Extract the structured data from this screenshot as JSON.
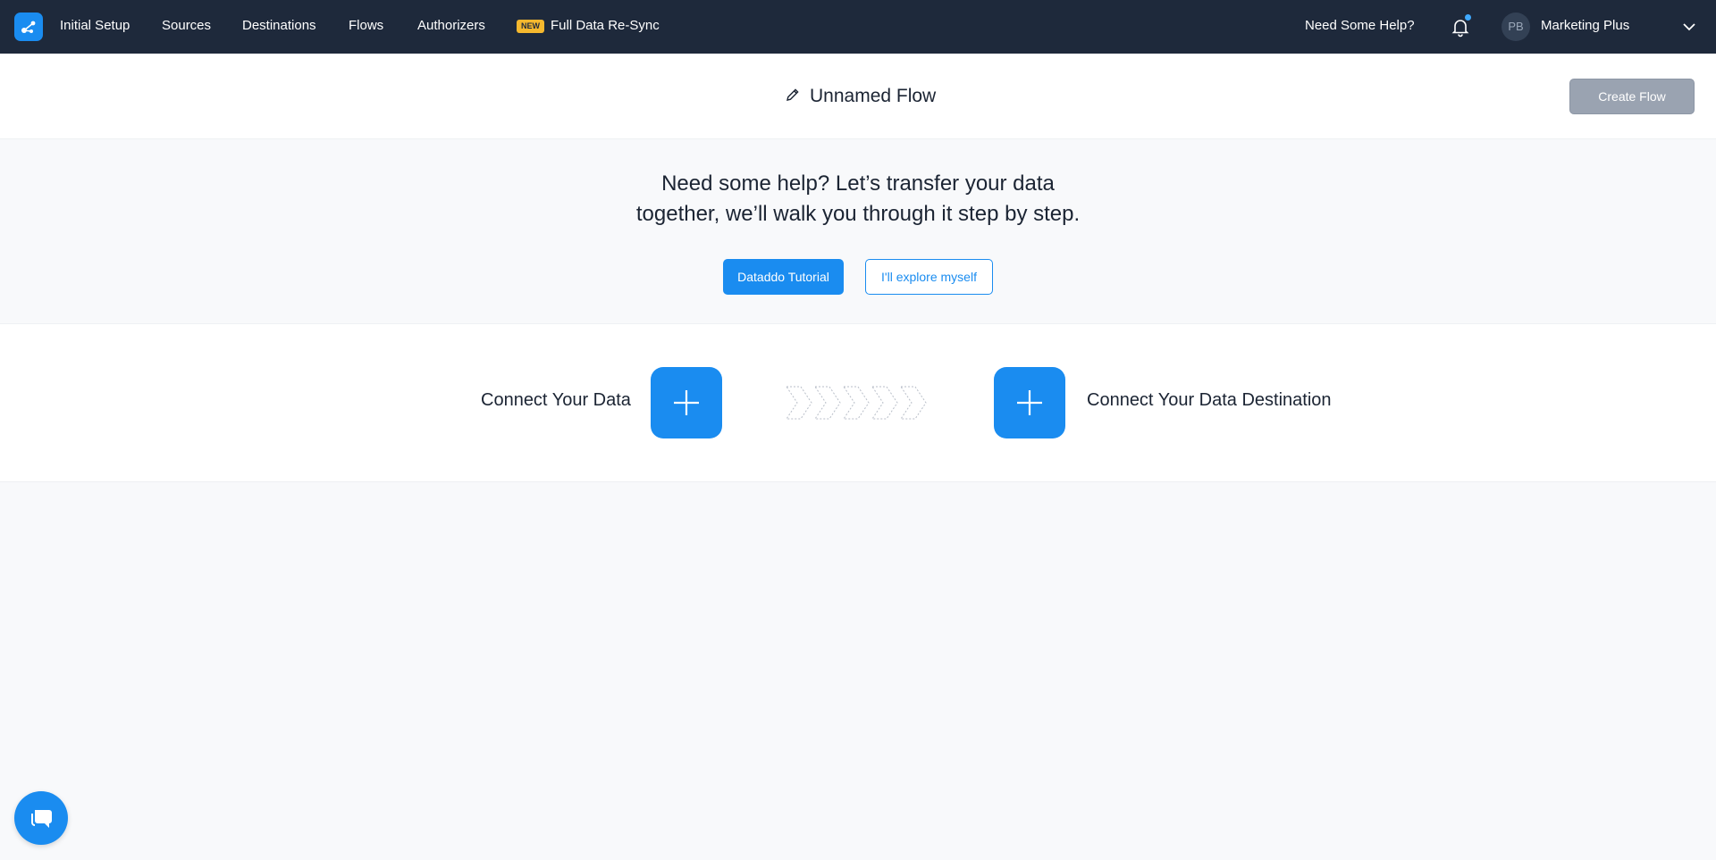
{
  "nav": {
    "items": [
      {
        "label": "Initial Setup"
      },
      {
        "label": "Sources"
      },
      {
        "label": "Destinations"
      },
      {
        "label": "Flows"
      },
      {
        "label": "Authorizers"
      },
      {
        "label": "Full Data Re-Sync",
        "badge": "NEW"
      }
    ],
    "help_label": "Need Some Help?",
    "user": {
      "initials": "PB",
      "name": "Marketing Plus"
    }
  },
  "header": {
    "flow_title": "Unnamed Flow",
    "create_button": "Create Flow"
  },
  "help": {
    "line1": "Need some help? Let’s transfer your data",
    "line2": "together, we’ll walk you through it step by step.",
    "tutorial_button": "Dataddo Tutorial",
    "explore_button": "I'll explore myself"
  },
  "connect": {
    "source_label": "Connect Your Data",
    "destination_label": "Connect Your Data Destination"
  },
  "colors": {
    "nav_bg": "#1e293b",
    "accent": "#1a8cf0",
    "badge": "#f5b82e",
    "disabled_button": "#9aa3b1"
  }
}
